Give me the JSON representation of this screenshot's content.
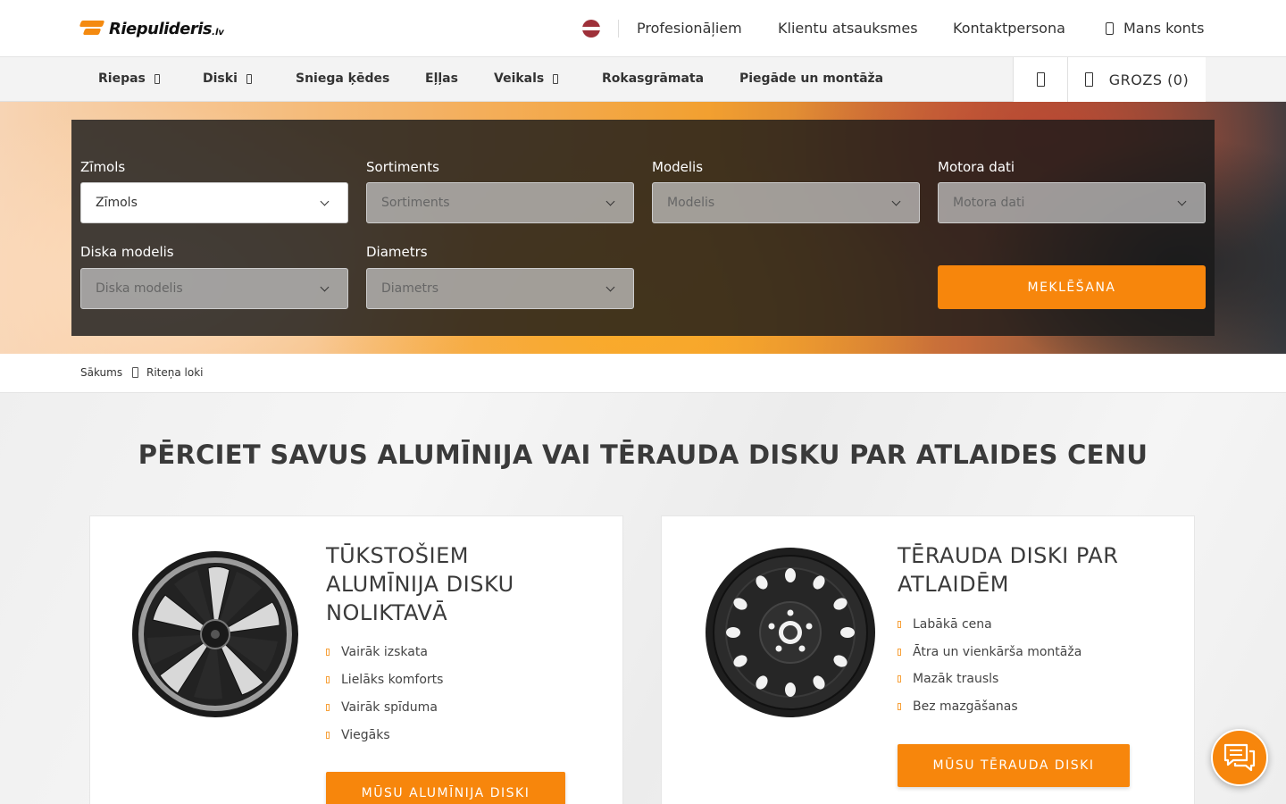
{
  "header": {
    "logo_text": "Riepulideris",
    "logo_tld": ".lv",
    "links": [
      "Profesionāļiem",
      "Klientu atsauksmes",
      "Kontaktpersona"
    ],
    "account_label": "Mans konts",
    "language": "LV"
  },
  "nav": {
    "items": [
      {
        "label": "Riepas",
        "has_caret": true
      },
      {
        "label": "Diski",
        "has_caret": true
      },
      {
        "label": "Sniega ķēdes",
        "has_caret": false
      },
      {
        "label": "Eļļas",
        "has_caret": false
      },
      {
        "label": "Veikals",
        "has_caret": true
      },
      {
        "label": "Rokasgrāmata",
        "has_caret": false
      },
      {
        "label": "Piegāde un montāža",
        "has_caret": false
      }
    ],
    "cart_label": "GROZS (0)"
  },
  "search": {
    "fields": [
      {
        "label": "Zīmols",
        "value": "Zīmols",
        "enabled": true
      },
      {
        "label": "Sortiments",
        "value": "Sortiments",
        "enabled": false
      },
      {
        "label": "Modelis",
        "value": "Modelis",
        "enabled": false
      },
      {
        "label": "Motora dati",
        "value": "Motora dati",
        "enabled": false
      },
      {
        "label": "Diska modelis",
        "value": "Diska modelis",
        "enabled": false
      },
      {
        "label": "Diametrs",
        "value": "Diametrs",
        "enabled": false
      }
    ],
    "button_label": "MEKLĒŠANA"
  },
  "breadcrumb": {
    "home": "Sākums",
    "current": "Riteņa loki"
  },
  "main": {
    "title": "PĒRCIET SAVUS ALUMĪNIJA VAI TĒRAUDA DISKU PAR ATLAIDES CENU",
    "cards": [
      {
        "title_lines": [
          "TŪKSTOŠIEM",
          "ALUMĪNIJA DISKU",
          "NOLIKTAVĀ"
        ],
        "features": [
          "Vairāk izskata",
          "Lielāks komforts",
          "Vairāk spīduma",
          "Viegāks"
        ],
        "button": "MŪSU ALUMĪNIJA DISKI"
      },
      {
        "title_lines": [
          "TĒRAUDA DISKI PAR",
          "ATLAIDĒM"
        ],
        "features": [
          "Labākā cena",
          "Ātra un vienkārša montāža",
          "Mazāk trausls",
          "Bez mazgāšanas"
        ],
        "button": "MŪSU TĒRAUDA DISKI"
      }
    ]
  },
  "colors": {
    "accent": "#f7860c",
    "flag_red": "#9e3039"
  }
}
